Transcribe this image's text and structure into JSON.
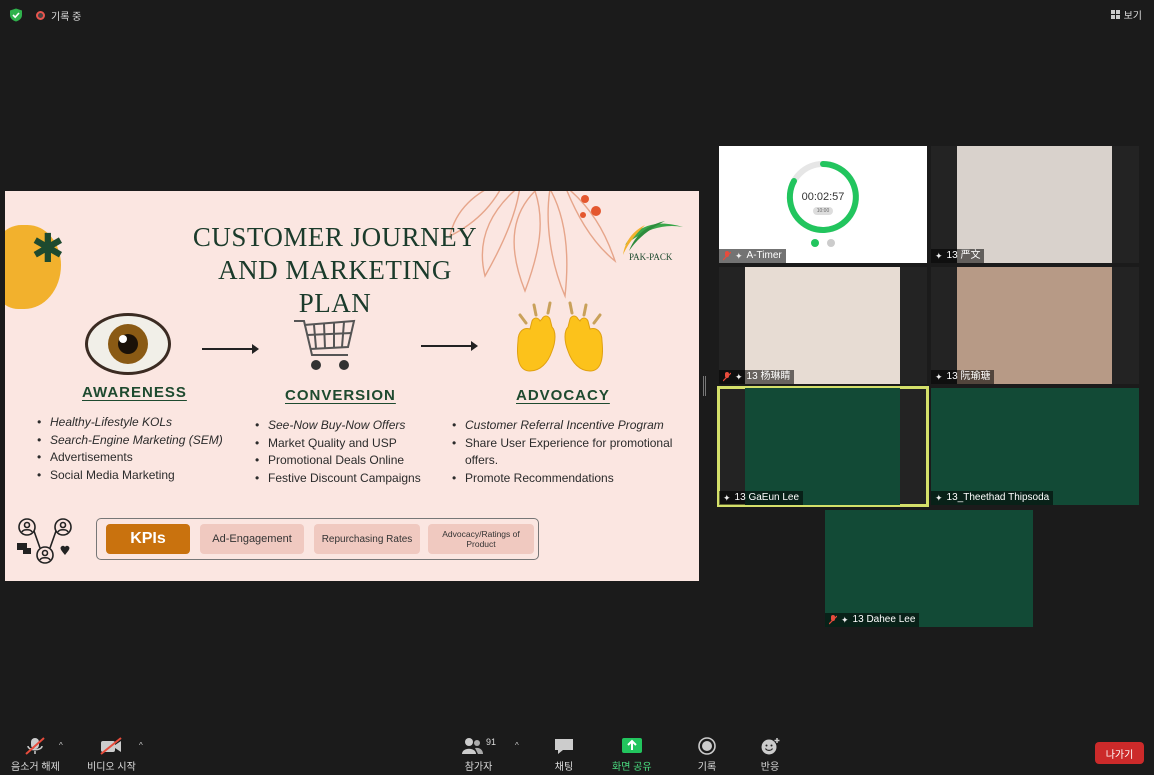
{
  "topbar": {
    "recording_label": "기록 중",
    "view_label": "보기"
  },
  "slide": {
    "title_line1": "CUSTOMER JOURNEY",
    "title_line2": "AND MARKETING PLAN",
    "logo_text": "PAK-PACK",
    "stages": [
      {
        "heading": "AWARENESS",
        "icon": "eye-emoji",
        "bullets": [
          "Healthy-Lifestyle KOLs",
          "Search-Engine Marketing (SEM)",
          "Advertisements",
          "Social Media Marketing"
        ]
      },
      {
        "heading": "CONVERSION",
        "icon": "shopping-cart",
        "bullets": [
          "See-Now Buy-Now Offers",
          "Market Quality and USP",
          "Promotional Deals Online",
          "Festive Discount Campaigns"
        ]
      },
      {
        "heading": "ADVOCACY",
        "icon": "raising-hands-emoji",
        "bullets": [
          "Customer Referral Incentive Program",
          "Share User Experience for promotional offers.",
          "Promote Recommendations"
        ]
      }
    ],
    "kpi_label": "KPIs",
    "kpis": [
      "Ad-Engagement",
      "Repurchasing Rates",
      "Advocacy/Ratings of Product"
    ]
  },
  "tiles": [
    {
      "name": "A-Timer",
      "timer": "00:02:57",
      "timer_sub": "10:00"
    },
    {
      "name": "13 严文"
    },
    {
      "name": "13 杨琳睛"
    },
    {
      "name": "13 阮瑜瑭"
    },
    {
      "name": "13 GaEun Lee",
      "active_speaker": true
    },
    {
      "name": "13_Theethad Thipsoda"
    },
    {
      "name": "13 Dahee Lee"
    }
  ],
  "toolbar": {
    "unmute": "음소거 해제",
    "start_video": "비디오 시작",
    "participants": "참가자",
    "participant_count": "91",
    "chat": "채팅",
    "share_screen": "화면 공유",
    "record": "기록",
    "reactions": "반응",
    "leave": "나가기"
  },
  "colors": {
    "accent_green": "#22c55e",
    "leave_red": "#cc2a2a",
    "active_speaker": "#d4e06a",
    "slide_bg": "#fbe6e1",
    "kpi_orange": "#c9720e"
  }
}
